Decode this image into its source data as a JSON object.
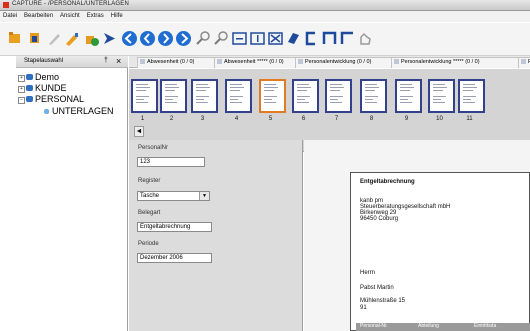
{
  "window": {
    "title": "CAPTURE - /PERSONAL/UNTERLAGEN"
  },
  "menu": [
    "Datei",
    "Bearbeiten",
    "Ansicht",
    "Extras",
    "Hilfe"
  ],
  "left_panel": {
    "title": "Stapelauswahl",
    "pin_label": "†",
    "close_label": "×",
    "tree": [
      {
        "label": "Demo",
        "expander": "+"
      },
      {
        "label": "KUNDE",
        "expander": "+"
      },
      {
        "label": "PERSONAL",
        "expander": "−"
      },
      {
        "label": "UNTERLAGEN",
        "expander": ""
      }
    ]
  },
  "tabs": [
    {
      "label": "Abwesenheit (0 / 0)"
    },
    {
      "label": "Abwesenheit ***** (0 / 0)"
    },
    {
      "label": "Personalentwicklung (0 / 0)"
    },
    {
      "label": "Personalentwicklung ***** (0 / 0)"
    },
    {
      "label": "P"
    }
  ],
  "thumbnails": [
    "1",
    "2",
    "3",
    "4",
    "5",
    "6",
    "7",
    "8",
    "9",
    "10",
    "11"
  ],
  "selected_thumbnail": "5",
  "scroll_left": "◄",
  "form": {
    "personalnr_label": "PersonalNr",
    "personalnr_value": "123",
    "register_label": "Register",
    "register_value": "Tasche",
    "register_arrow": "▼",
    "belegart_label": "Belegart",
    "belegart_value": "Entgeltabrechnung",
    "periode_label": "Periode",
    "periode_value": "Dezember 2006"
  },
  "document": {
    "heading": "Entgeltabrechnung",
    "sender": [
      "kanb pm",
      "Steuerberatungsgesellschaft mbH",
      "Birkenweg 29",
      "96450 Coburg"
    ],
    "recipient": [
      "Herrn",
      "Pabst Martin",
      "Mühlenstraße 15",
      "91"
    ],
    "footer_cells": [
      "Personal-Nr.",
      "Abteilung",
      "Eintrittsda"
    ]
  },
  "colors": {
    "selected_border": "#e07b24",
    "thumb_border": "#33418a",
    "tree_icon": "#2e6fc4",
    "title_icon": "#d8301c"
  }
}
